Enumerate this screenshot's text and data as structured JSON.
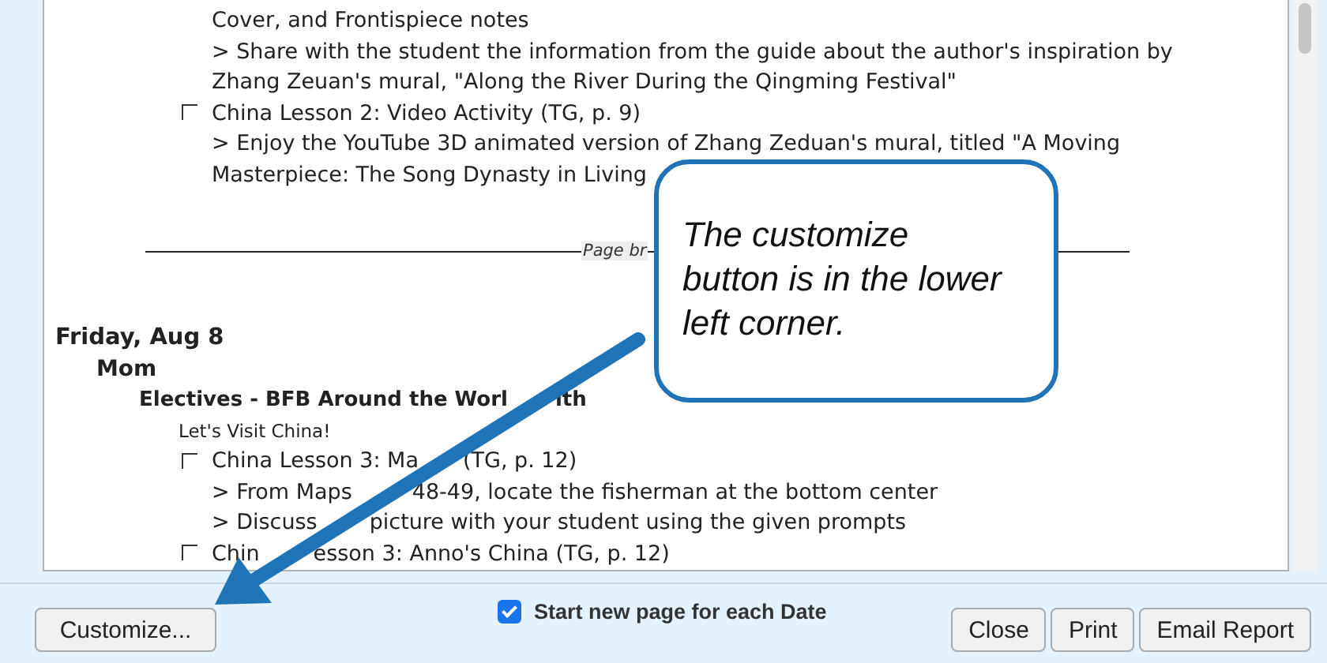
{
  "report": {
    "items": [
      {
        "kind": "note",
        "text": "Cover, and Frontispiece notes"
      },
      {
        "kind": "note",
        "text": "> Share with the student the information from the guide about the author's inspiration by"
      },
      {
        "kind": "note",
        "text": "Zhang Zeuan's mural, \"Along the River During the Qingming Festival\""
      },
      {
        "kind": "task",
        "text": "China Lesson 2: Video Activity (TG, p. 9)",
        "checked": false
      },
      {
        "kind": "note",
        "text": "> Enjoy the YouTube 3D animated version of Zhang Zeduan's mural, titled \"A Moving"
      },
      {
        "kind": "note",
        "text": "Masterpiece: The Song Dynasty in Living"
      },
      {
        "kind": "page-break",
        "text": "Page br"
      },
      {
        "kind": "date",
        "text": "Friday, Aug 8"
      },
      {
        "kind": "person",
        "text": "Mom"
      },
      {
        "kind": "subject",
        "parts": [
          "Electives - BFB Around the Worl",
          "ith"
        ]
      },
      {
        "kind": "heading",
        "text": "Let's Visit China!"
      },
      {
        "kind": "task",
        "parts": [
          "China Lesson 3: Ma",
          "(TG, p. 12)"
        ],
        "checked": false
      },
      {
        "kind": "note",
        "parts": [
          "> From Maps",
          "48-49, locate the fisherman at the bottom center"
        ]
      },
      {
        "kind": "note",
        "parts": [
          "> Discuss",
          "picture with your student using the given prompts"
        ]
      },
      {
        "kind": "task",
        "parts": [
          "Chin",
          "esson 3: Anno's China (TG, p. 12)"
        ],
        "checked": false
      }
    ]
  },
  "callout": {
    "text": "The customize button is in the lower left corner."
  },
  "footer": {
    "customize": "Customize...",
    "new_page": {
      "label": "Start new page for each Date",
      "checked": true
    },
    "buttons": [
      "Close",
      "Print",
      "Email Report"
    ]
  }
}
